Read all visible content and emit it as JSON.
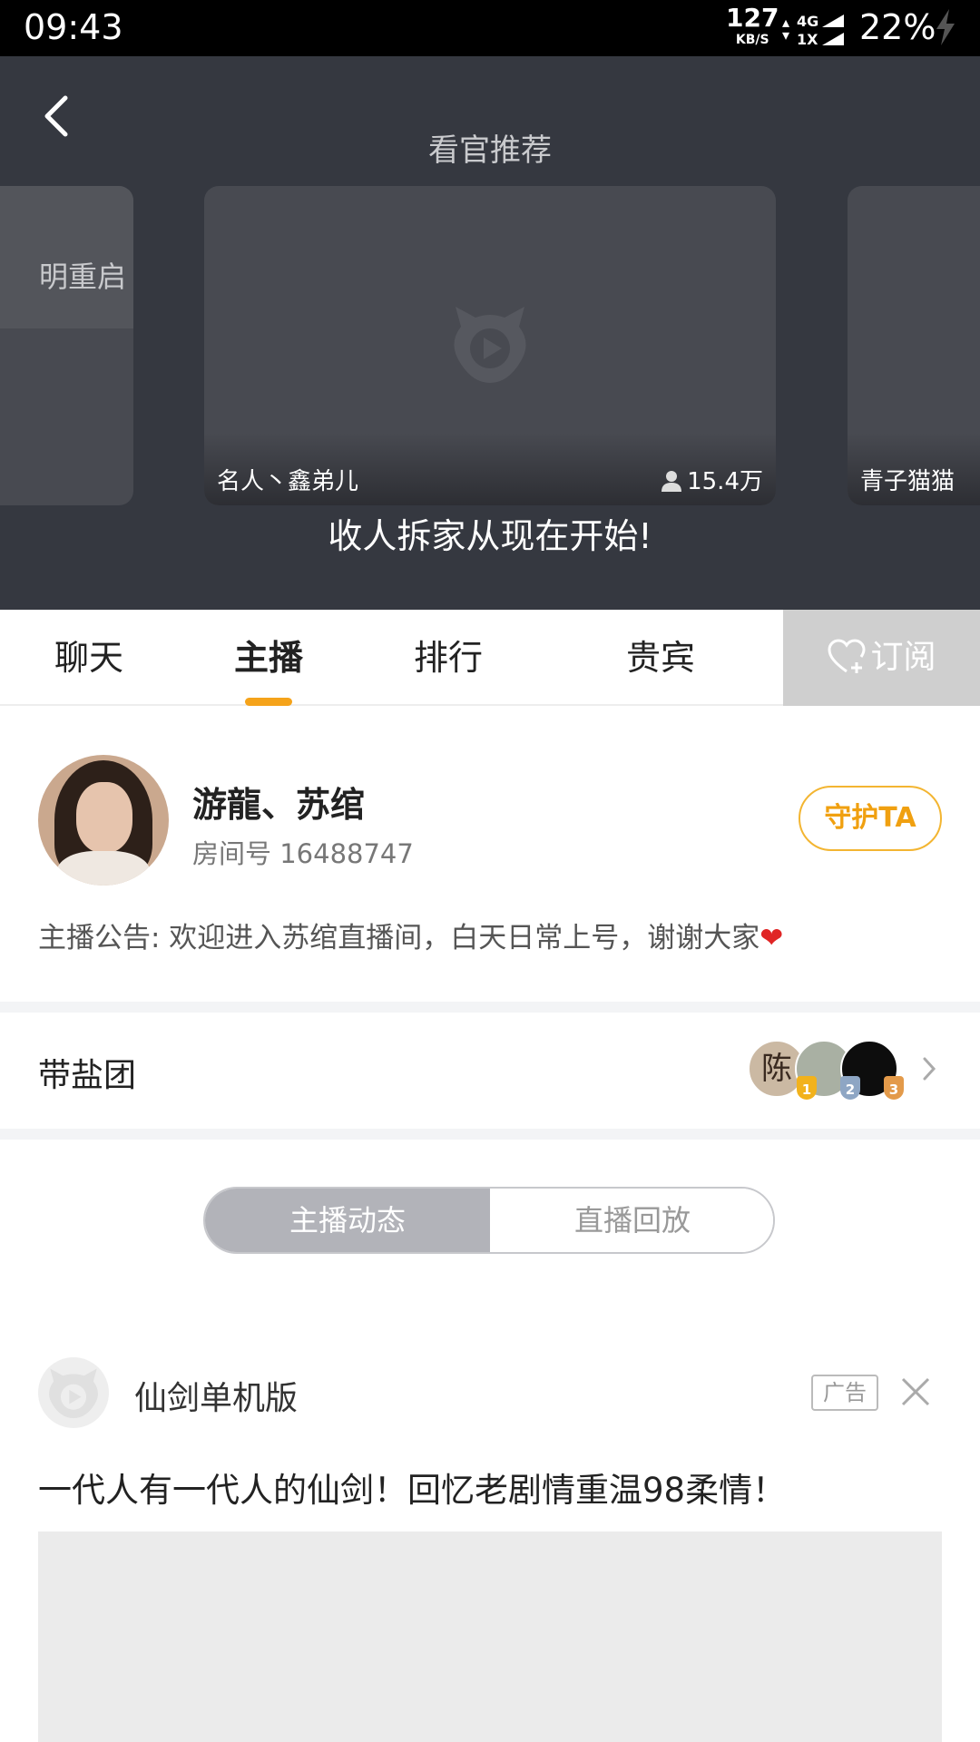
{
  "status_bar": {
    "time": "09:43",
    "net_speed": "127",
    "net_speed_unit": "KB/S",
    "net_type_top": "4G",
    "net_type_bottom": "1X",
    "battery": "22%"
  },
  "header": {
    "title": "看官推荐",
    "cards": [
      {
        "title_partial": "明重启"
      },
      {
        "name": "名人丶鑫弟儿",
        "viewers": "15.4万"
      },
      {
        "name": "青子猫猫"
      }
    ],
    "stream_title": "收人拆家从现在开始!"
  },
  "tabs": {
    "items": [
      "聊天",
      "主播",
      "排行",
      "贵宾"
    ],
    "active": "主播",
    "subscribe_label": "订阅"
  },
  "streamer": {
    "name": "游龍、苏绾",
    "room_no": "房间号 16488747",
    "guard_label": "守护TA",
    "notice": "主播公告: 欢迎进入苏绾直播间，白天日常上号，谢谢大家",
    "notice_heart": "❤"
  },
  "fan_group": {
    "label": "带盐团",
    "ranks": [
      "1",
      "2",
      "3"
    ],
    "avatar1_char": "陈"
  },
  "segment": {
    "active": "主播动态",
    "inactive": "直播回放"
  },
  "ad": {
    "title": "仙剑单机版",
    "tag": "广告",
    "text": "一代人有一代人的仙剑！回忆老剧情重温98柔情！"
  },
  "colors": {
    "header_bg": "#353840",
    "accent": "#f5a31a",
    "subscribe_bg": "#cfcfcf"
  }
}
